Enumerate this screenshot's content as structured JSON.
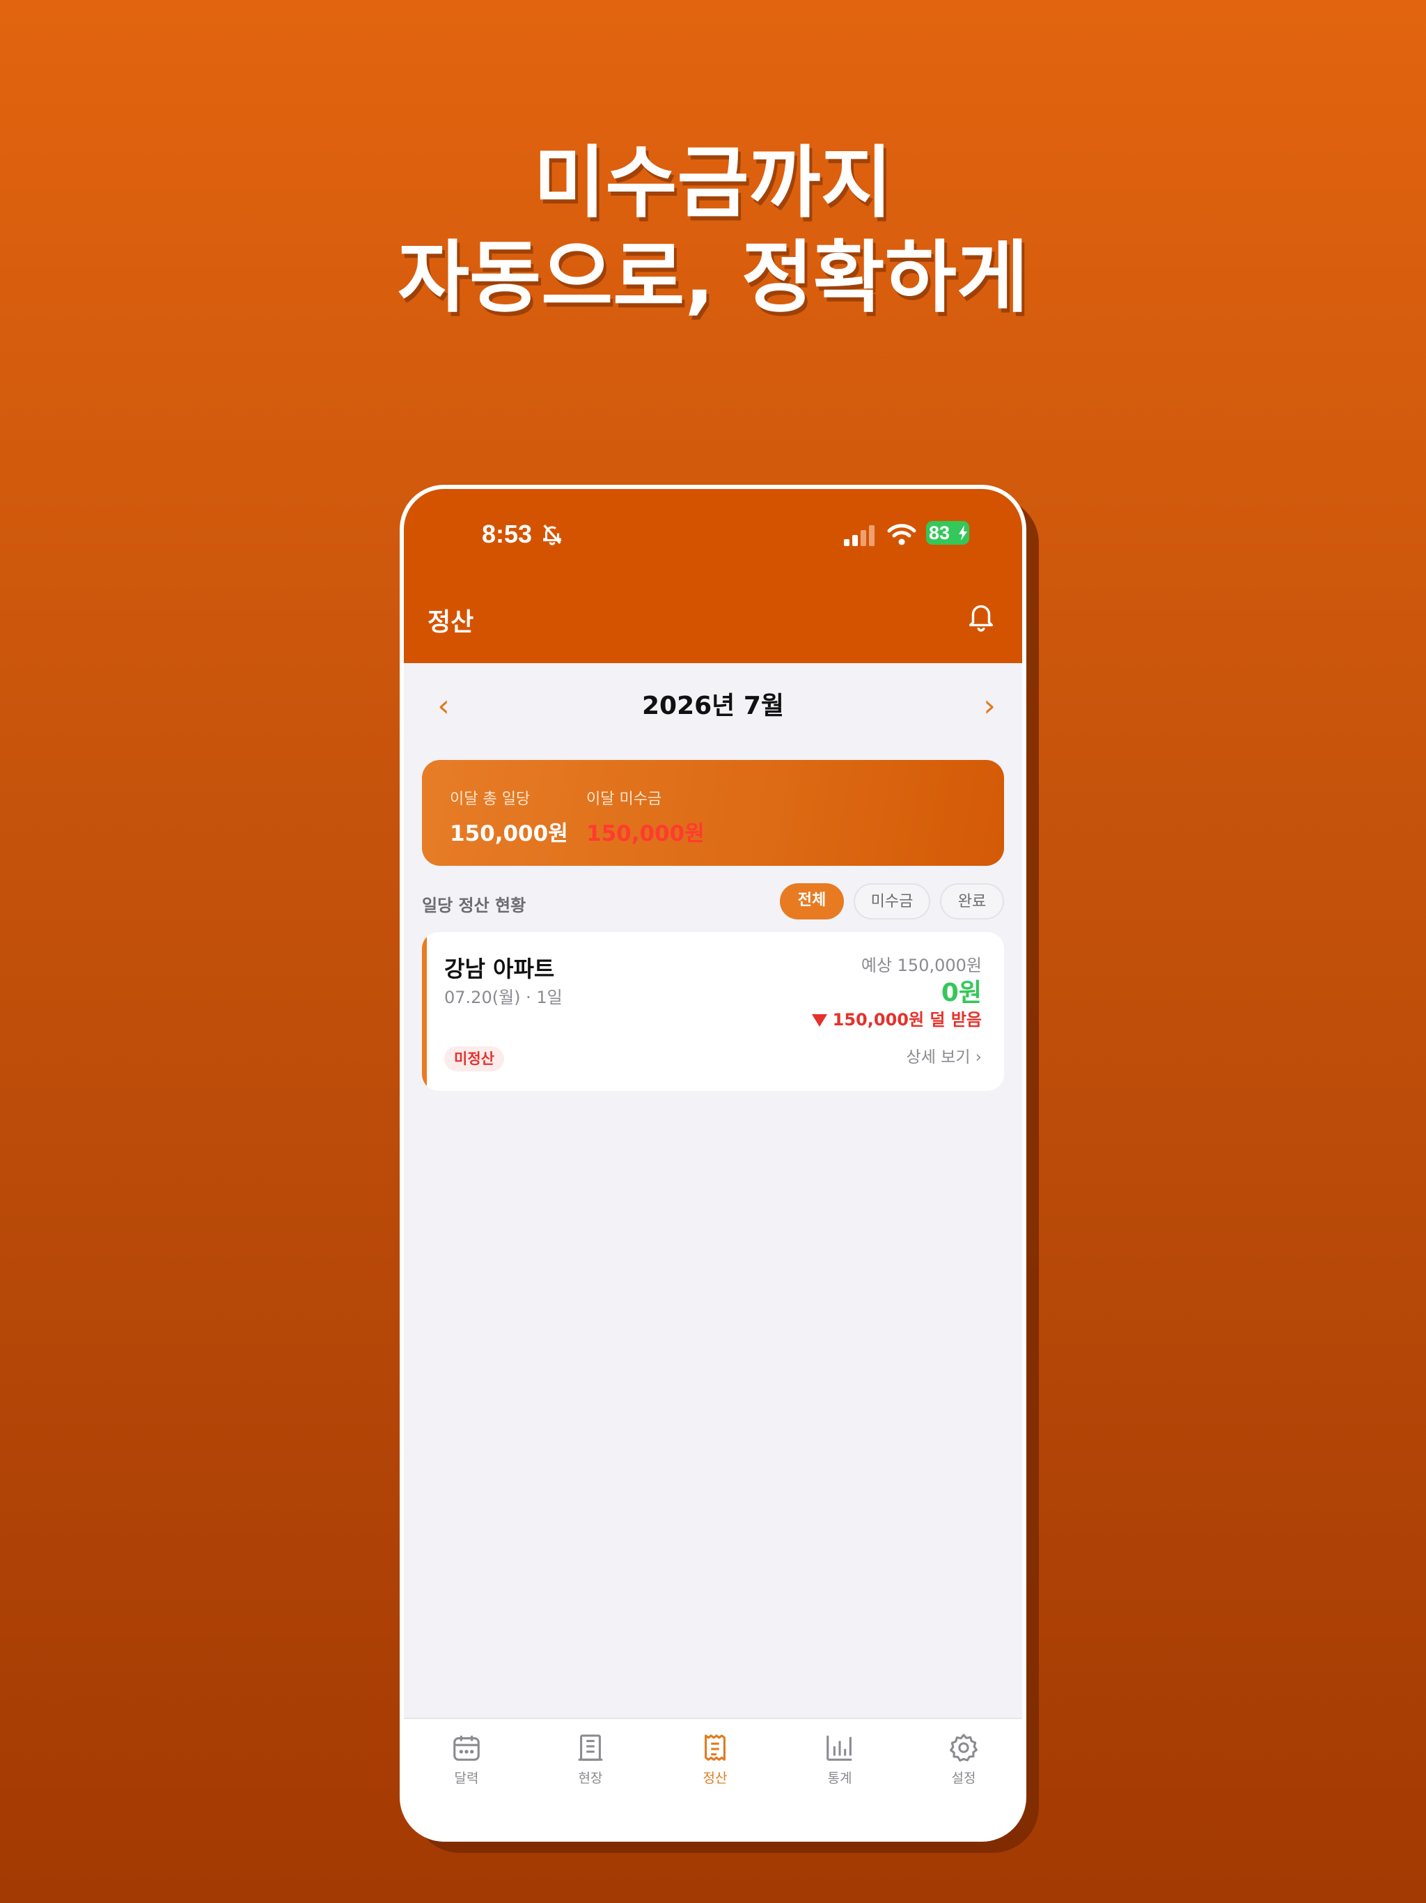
{
  "headline": {
    "line1": "미수금까지",
    "line2": "자동으로, 정확하게"
  },
  "status_bar": {
    "time": "8:53",
    "battery": "83"
  },
  "header": {
    "title": "정산"
  },
  "month_nav": {
    "label": "2026년 7월",
    "prev": "‹",
    "next": "›"
  },
  "summary": {
    "total_label": "이달 총 일당",
    "total_value": "150,000원",
    "unpaid_label": "이달 미수금",
    "unpaid_value": "150,000원"
  },
  "section": {
    "title": "일당 정산 현황",
    "filters": [
      "전체",
      "미수금",
      "완료"
    ],
    "active_filter": "전체"
  },
  "settlements": [
    {
      "site": "강남 아파트",
      "date": "07.20(월) · 1일",
      "expected": "예상 150,000원",
      "received": "0원",
      "shortfall": "150,000원 덜 받음",
      "status": "미정산",
      "detail": "상세 보기 ›"
    }
  ],
  "tabs": [
    {
      "label": "달력",
      "icon": "calendar-icon"
    },
    {
      "label": "현장",
      "icon": "building-icon"
    },
    {
      "label": "정산",
      "icon": "receipt-icon"
    },
    {
      "label": "통계",
      "icon": "bar-chart-icon"
    },
    {
      "label": "설정",
      "icon": "gear-icon"
    }
  ],
  "colors": {
    "brand": "#d45300",
    "accent": "#e87b22",
    "negative": "#e5312b",
    "positive": "#34c759"
  }
}
